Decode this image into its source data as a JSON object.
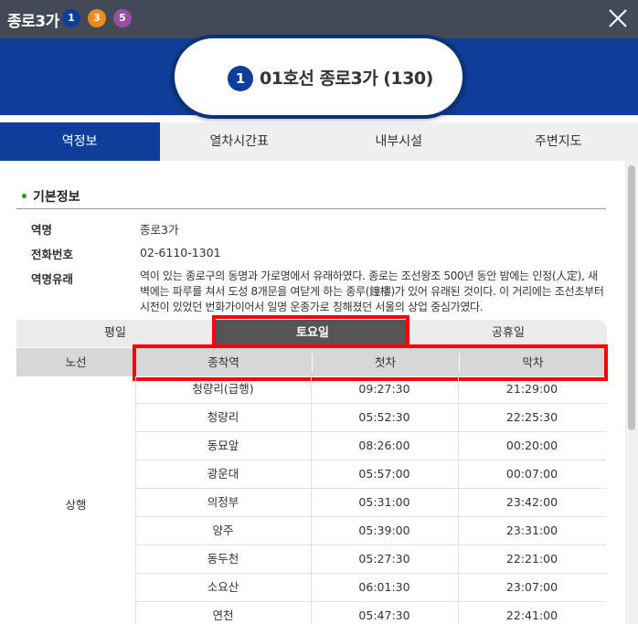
{
  "topbar": {
    "title": "종로3가",
    "lines": [
      {
        "number": "1",
        "color": "#0d3f9a"
      },
      {
        "number": "3",
        "color": "#ef8a1d"
      },
      {
        "number": "5",
        "color": "#9b4ea2"
      }
    ],
    "close_icon": "close-icon"
  },
  "header": {
    "line_number": "1",
    "title": "01호선 종로3가 (130)"
  },
  "tabs": [
    "역정보",
    "열차시간표",
    "내부시설",
    "주변지도"
  ],
  "basic_info": {
    "section_title": "기본정보",
    "name_label": "역명",
    "name_value": "종로3가",
    "phone_label": "전화번호",
    "phone_value": "02-6110-1301",
    "origin_label": "역명유래",
    "origin_value": "역이 있는 종로구의 동명과 가로명에서 유래하였다. 종로는 조선왕조 500년 동안 밤에는 인정(人定), 새벽에는 파루를 쳐서 도성 8개문을 여닫게 하는 종루(鐘樓)가 있어 유래된 것이다. 이 거리에는 조선초부터 시전이 있었던 번화가이어서 일명 운종가로 칭해졌던 서울의 상업 중심가였다."
  },
  "day_tabs": [
    "평일",
    "토요일",
    "공휴일"
  ],
  "table": {
    "headers": [
      "노선",
      "종착역",
      "첫차",
      "막차"
    ],
    "direction": "상행",
    "rows": [
      {
        "dest": "청량리(급행)",
        "first": "09:27:30",
        "last": "21:29:00"
      },
      {
        "dest": "청량리",
        "first": "05:52:30",
        "last": "22:25:30"
      },
      {
        "dest": "동묘앞",
        "first": "08:26:00",
        "last": "00:20:00"
      },
      {
        "dest": "광운대",
        "first": "05:57:00",
        "last": "00:07:00"
      },
      {
        "dest": "의정부",
        "first": "05:31:00",
        "last": "23:42:00"
      },
      {
        "dest": "양주",
        "first": "05:39:00",
        "last": "23:31:00"
      },
      {
        "dest": "동두천",
        "first": "05:27:30",
        "last": "22:21:00"
      },
      {
        "dest": "소요산",
        "first": "06:01:30",
        "last": "23:07:00"
      },
      {
        "dest": "연천",
        "first": "05:47:30",
        "last": "22:41:00"
      }
    ]
  },
  "colors": {
    "accent_blue": "#0d3f9a",
    "topbar": "#424a57",
    "highlight": "#ff0000"
  }
}
